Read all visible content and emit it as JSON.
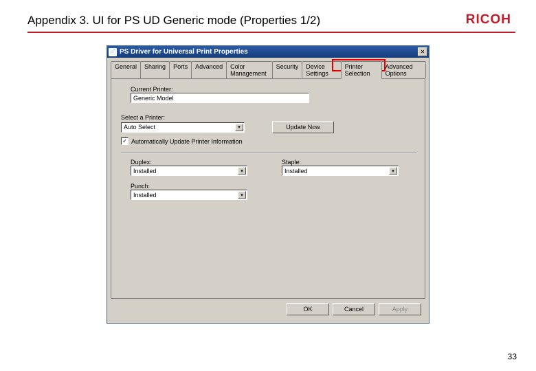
{
  "slide": {
    "title": "Appendix 3. UI for PS UD Generic mode (Properties 1/2)",
    "brand": "RICOH",
    "page_number": "33"
  },
  "dialog": {
    "title": "PS Driver for Universal Print Properties",
    "tabs": [
      "General",
      "Sharing",
      "Ports",
      "Advanced",
      "Color Management",
      "Security",
      "Device Settings",
      "Printer Selection",
      "Advanced Options"
    ],
    "active_tab": "Printer Selection",
    "current_printer_label": "Current Printer:",
    "current_printer_value": "Generic Model",
    "select_printer_label": "Select a Printer:",
    "select_printer_value": "Auto Select",
    "update_now_label": "Update Now",
    "auto_update_label": "Automatically Update Printer Information",
    "auto_update_checked": "✓",
    "duplex_label": "Duplex:",
    "duplex_value": "Installed",
    "staple_label": "Staple:",
    "staple_value": "Installed",
    "punch_label": "Punch:",
    "punch_value": "Installed",
    "buttons": {
      "ok": "OK",
      "cancel": "Cancel",
      "apply": "Apply"
    }
  }
}
